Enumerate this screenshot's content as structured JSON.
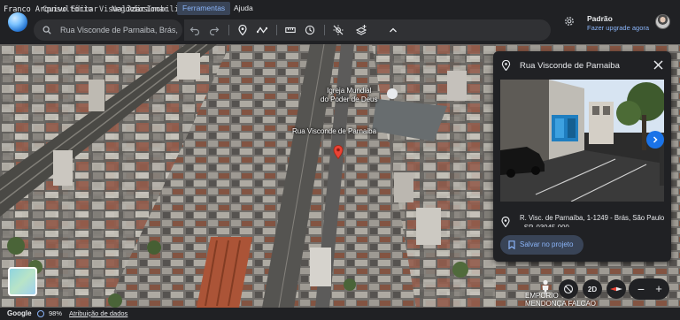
{
  "menu": {
    "overlapped_items": [
      "Franco Arquivo",
      "Consultório",
      "Editar",
      "Visualizar",
      "Negócios",
      "Adicionar",
      "Imobiliária"
    ],
    "tools_label": "Ferramentas",
    "help_label": "Ajuda"
  },
  "search": {
    "value": "Rua Visconde de Parnaiba, Brás,"
  },
  "toolbar": {
    "icons": [
      "undo-icon",
      "redo-icon",
      "placemark-icon",
      "path-icon",
      "ruler-icon",
      "history-icon",
      "no-sun-icon",
      "layers-add-icon",
      "collapse-icon"
    ]
  },
  "account": {
    "name": "Padrão",
    "upgrade_link": "Fazer upgrade agora"
  },
  "map": {
    "labels": {
      "church": "Igreja Mundial\ndo Poder de Deus",
      "street": "Rua Visconde de Parnaiba",
      "bottom_place": "EMPORIO\nMENDONÇA FALCAO"
    },
    "colors": {
      "pin": "#ea4335",
      "accent": "#8ab4f8",
      "button": "#1a73e8"
    }
  },
  "panel": {
    "title": "Rua Visconde de Parnaiba",
    "address": "R. Visc. de Parnaíba, 1-1249 - Brás, São Paulo - SP, 03045-000",
    "save_label": "Salvar no projeto"
  },
  "controls": {
    "view_2d_label": "2D"
  },
  "status": {
    "google": "Google",
    "load_percent": "98%",
    "attribution": "Atribuição de dados"
  }
}
